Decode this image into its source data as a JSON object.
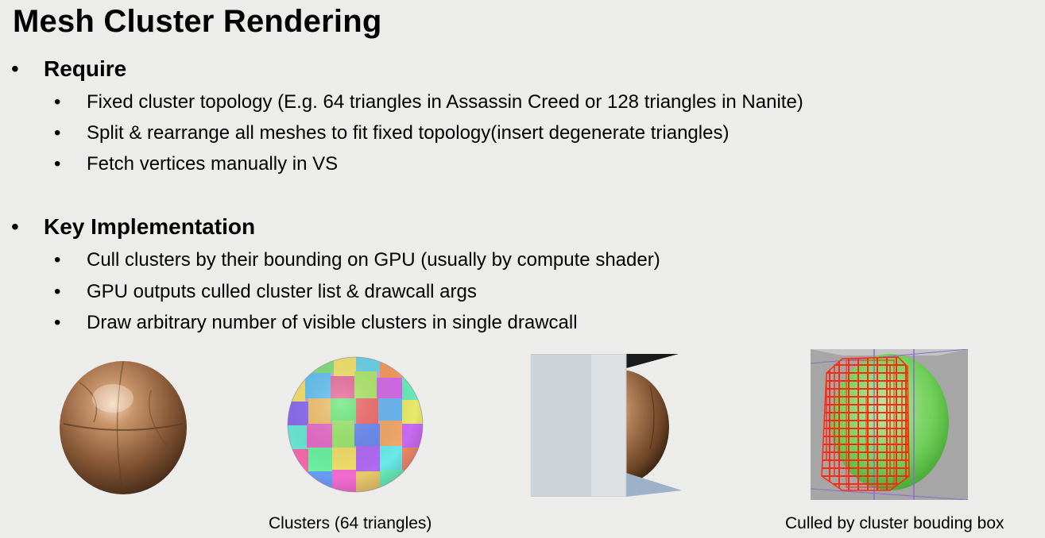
{
  "slide": {
    "title": "Mesh Cluster Rendering"
  },
  "sections": [
    {
      "bullet": "•",
      "heading": "Require",
      "items": [
        {
          "bullet": "•",
          "text": "Fixed cluster topology (E.g. 64 triangles in Assassin Creed or 128 triangles in Nanite)"
        },
        {
          "bullet": "•",
          "text": "Split & rearrange all meshes to fit fixed topology(insert degenerate triangles)"
        },
        {
          "bullet": "•",
          "text": "Fetch vertices manually in VS"
        }
      ]
    },
    {
      "bullet": "•",
      "heading": "Key Implementation",
      "items": [
        {
          "bullet": "•",
          "text": "Cull clusters by their bounding on GPU (usually by compute shader)"
        },
        {
          "bullet": "•",
          "text": "GPU outputs culled cluster list & drawcall args"
        },
        {
          "bullet": "•",
          "text": "Draw arbitrary number of visible clusters in single drawcall"
        }
      ]
    }
  ],
  "figures": {
    "captions": {
      "clusters": "Clusters (64 triangles)",
      "culled": "Culled by cluster bouding box"
    }
  },
  "colors": {
    "background": "#ececea",
    "sphere_bronze": "#9a6a45",
    "bbox_red": "#ff2a10",
    "sphere_green": "#5fbf4a"
  }
}
